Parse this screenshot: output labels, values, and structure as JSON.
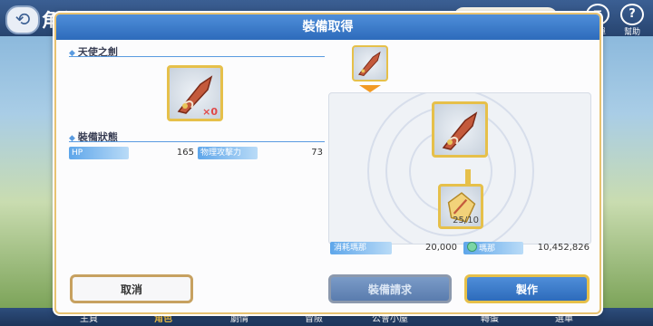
{
  "background": {
    "title": "角色",
    "money_display": "10,452,826",
    "top_icons": [
      {
        "icon": "menu-icon",
        "label": "選單"
      },
      {
        "icon": "help-icon",
        "label": "幫助"
      }
    ],
    "bottom_nav": [
      "主頁",
      "角色",
      "劇情",
      "冒險",
      "公會小屋",
      "轉蛋",
      "選單"
    ]
  },
  "dialog": {
    "title": "裝備取得",
    "item_name": "天使之劍",
    "item_quantity": "×0",
    "status_title": "裝備狀態",
    "stats": [
      {
        "label": "HP",
        "value": "165"
      },
      {
        "label": "物理攻擊力",
        "value": "73"
      }
    ],
    "fragment_progress": "25/10",
    "cost_label": "消耗瑪那",
    "cost_value": "20,000",
    "mana_label": "瑪那",
    "mana_value": "10,452,826",
    "buttons": {
      "cancel": "取消",
      "request": "裝備請求",
      "craft": "製作"
    }
  },
  "colors": {
    "header_blue": "#3a7bcb",
    "gold_border": "#e6c04a",
    "arrow_orange": "#f29a24",
    "quantity_red": "#e04848"
  }
}
